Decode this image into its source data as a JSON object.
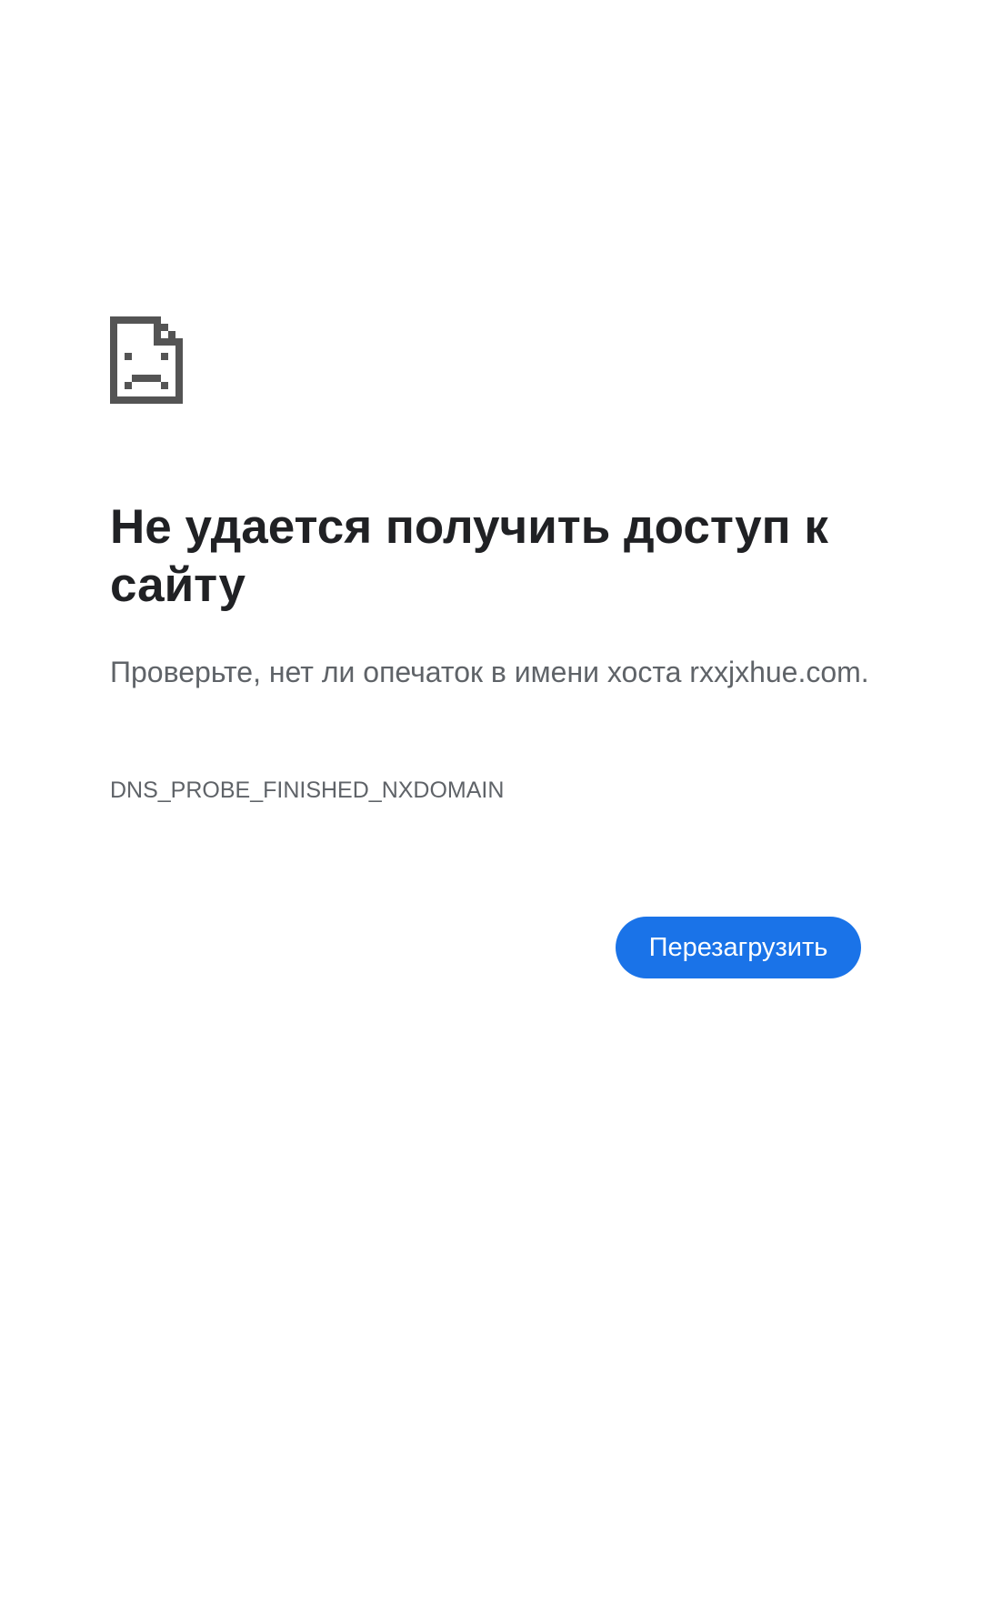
{
  "icon": "sad-page-icon",
  "error": {
    "title": "Не удается получить доступ к сайту",
    "message": "Проверьте, нет ли опечаток в имени хоста rxxjxhue.com.",
    "code": "DNS_PROBE_FINISHED_NXDOMAIN"
  },
  "actions": {
    "reload_label": "Перезагрузить"
  },
  "colors": {
    "background": "#ffffff",
    "title": "#202124",
    "text": "#5f6368",
    "icon": "#545454",
    "button": "#1a73e8",
    "button_text": "#ffffff"
  }
}
